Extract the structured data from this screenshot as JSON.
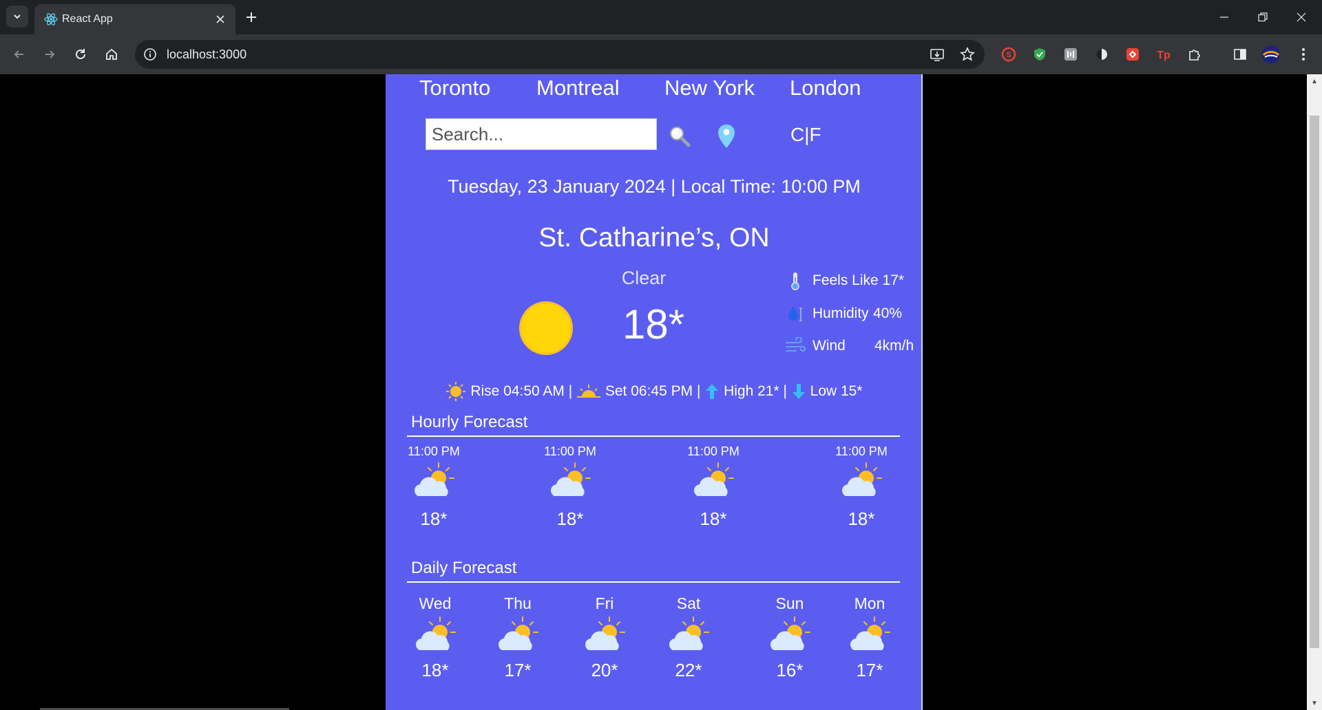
{
  "browser": {
    "tab_title": "React App",
    "url": "localhost:3000"
  },
  "app": {
    "colors": {
      "background": "#5b5df0",
      "sun": "#ffd60a",
      "arrow": "#38bdf8"
    },
    "cities": [
      "Toronto",
      "Montreal",
      "New York",
      "London"
    ],
    "search_placeholder": "Search...",
    "units_label": "C|F",
    "datetime": "Tuesday, 23 January 2024 | Local Time: 10:00 PM",
    "location": "St. Catharine’s, ON",
    "condition": "Clear",
    "temperature": "18*",
    "details": {
      "feels_like": "Feels Like 17*",
      "humidity_label": "Humidity",
      "humidity_value": "40%",
      "wind_label": "Wind",
      "wind_value": "4km/h"
    },
    "sun": {
      "rise": "Rise 04:50 AM |",
      "set": "Set 06:45 PM |",
      "high": "High 21* |",
      "low": "Low 15*"
    },
    "hourly_title": "Hourly Forecast",
    "hourly": [
      {
        "time": "11:00 PM",
        "temp": "18*",
        "icon": "partly-cloudy-icon"
      },
      {
        "time": "11:00 PM",
        "temp": "18*",
        "icon": "partly-cloudy-icon"
      },
      {
        "time": "11:00 PM",
        "temp": "18*",
        "icon": "partly-cloudy-icon"
      },
      {
        "time": "11:00 PM",
        "temp": "18*",
        "icon": "partly-cloudy-icon"
      }
    ],
    "daily_title": "Daily Forecast",
    "daily": [
      {
        "day": "Wed",
        "temp": "18*",
        "icon": "partly-cloudy-icon"
      },
      {
        "day": "Thu",
        "temp": "17*",
        "icon": "partly-cloudy-icon"
      },
      {
        "day": "Fri",
        "temp": "20*",
        "icon": "partly-cloudy-icon"
      },
      {
        "day": "Sat",
        "temp": "22*",
        "icon": "partly-cloudy-icon"
      },
      {
        "day": "Sun",
        "temp": "16*",
        "icon": "partly-cloudy-icon"
      },
      {
        "day": "Mon",
        "temp": "17*",
        "icon": "partly-cloudy-icon"
      }
    ]
  }
}
